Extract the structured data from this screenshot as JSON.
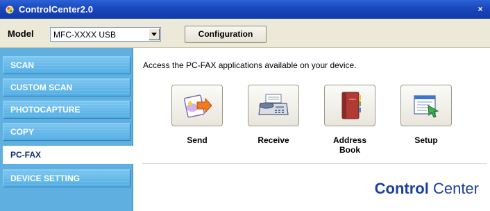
{
  "window": {
    "title": "ControlCenter2.0",
    "close_label": "×"
  },
  "toolbar": {
    "model_label": "Model",
    "model_value": "MFC-XXXX USB",
    "configuration_label": "Configuration"
  },
  "sidebar": {
    "items": [
      {
        "label": "SCAN",
        "active": false
      },
      {
        "label": "CUSTOM SCAN",
        "active": false
      },
      {
        "label": "PHOTOCAPTURE",
        "active": false
      },
      {
        "label": "COPY",
        "active": false
      },
      {
        "label": "PC-FAX",
        "active": true
      },
      {
        "label": "DEVICE SETTING",
        "active": false
      }
    ]
  },
  "main": {
    "description": "Access the  PC-FAX  applications available on your device.",
    "apps": [
      {
        "label": "Send",
        "icon": "send-icon"
      },
      {
        "label": "Receive",
        "icon": "fax-machine-icon"
      },
      {
        "label": "Address Book",
        "icon": "address-book-icon"
      },
      {
        "label": "Setup",
        "icon": "setup-icon"
      }
    ]
  },
  "brand": {
    "strong": "Control",
    "light": " Center"
  },
  "colors": {
    "titlebar": "#1a47bd",
    "sidebar": "#5fb0e0",
    "active_item_text": "#0d2a6e",
    "brand": "#1a3fa0"
  }
}
